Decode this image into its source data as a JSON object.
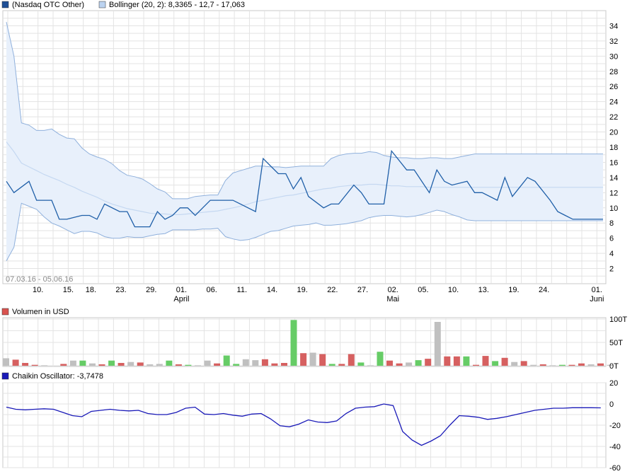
{
  "chart_data": [
    {
      "type": "line",
      "panel": "price",
      "legend": [
        {
          "label": "(Nasdaq OTC Other)",
          "color": "#1f5fa8"
        },
        {
          "label": "Bollinger (20, 2): 8,3365 - 12,7 - 17,063",
          "color": "#9cbde6"
        }
      ],
      "date_range": "07.03.16 - 05.06.16",
      "ylim": [
        0,
        36
      ],
      "yticks": [
        2,
        4,
        6,
        8,
        10,
        12,
        14,
        16,
        18,
        20,
        22,
        24,
        26,
        28,
        30,
        32,
        34
      ],
      "x_date_labels": [
        "10.",
        "15.",
        "18.",
        "23.",
        "29.",
        "01.",
        "06.",
        "11.",
        "14.",
        "19.",
        "22.",
        "27.",
        "02.",
        "05.",
        "10.",
        "13.",
        "19.",
        "24.",
        "01."
      ],
      "x_date_positions": [
        4,
        8,
        11,
        15,
        19,
        23,
        27,
        31,
        35,
        39,
        43,
        47,
        51,
        55,
        59,
        63,
        67,
        71,
        78
      ],
      "x_month_labels": [
        {
          "label": "April",
          "at": 23
        },
        {
          "label": "Mai",
          "at": 51
        },
        {
          "label": "Juni",
          "at": 78
        }
      ],
      "x_count": 80,
      "grid": true,
      "series": [
        {
          "x": [
            0,
            1,
            3,
            4,
            6,
            7,
            8,
            10,
            11,
            12,
            13,
            15,
            16,
            17,
            18,
            19,
            20,
            21,
            22,
            23,
            24,
            25,
            26,
            27,
            28,
            29,
            30,
            31,
            32,
            33,
            34,
            36,
            37,
            38,
            39,
            40,
            42,
            43,
            44,
            46,
            47,
            48,
            50,
            51,
            53,
            54,
            56,
            57,
            58,
            59,
            61,
            62,
            63,
            65,
            66,
            67,
            69,
            70,
            72,
            73,
            74,
            75,
            76,
            77,
            78,
            79
          ],
          "values": [
            13.5,
            12,
            13.5,
            11,
            11,
            8.5,
            8.5,
            9,
            9,
            8.5,
            10.5,
            9.5,
            9.5,
            7.5,
            7.5,
            7.5,
            9.5,
            8.5,
            9,
            10,
            10,
            9,
            10,
            11,
            11,
            11,
            11,
            10.5,
            10,
            9.5,
            16.5,
            14.5,
            14.5,
            12.5,
            14,
            11.5,
            10,
            10.5,
            10.5,
            13,
            12,
            10.5,
            10.5,
            17.5,
            15,
            15,
            12,
            15,
            13.5,
            13,
            13.5,
            12,
            12,
            11,
            14,
            11.5,
            14,
            13.5,
            11,
            9.5,
            9,
            8.5,
            8.5,
            8.5,
            8.5,
            8.5
          ]
        },
        {
          "name": "Bollinger (20, 2)",
          "x": [
            0,
            1,
            2,
            3,
            4,
            5,
            6,
            7,
            8,
            9,
            10,
            11,
            12,
            13,
            14,
            15,
            16,
            17,
            18,
            19,
            20,
            21,
            22,
            23,
            24,
            25,
            26,
            27,
            28,
            29,
            30,
            31,
            32,
            33,
            34,
            35,
            36,
            37,
            38,
            39,
            40,
            41,
            42,
            43,
            44,
            45,
            46,
            47,
            48,
            49,
            50,
            51,
            52,
            53,
            54,
            55,
            56,
            57,
            58,
            59,
            60,
            61,
            62,
            63,
            64,
            65,
            66,
            67,
            68,
            69,
            70,
            71,
            72,
            73,
            74,
            75,
            76,
            77,
            78,
            79
          ],
          "upper": [
            34.5,
            30,
            21.2,
            20.9,
            20.2,
            20.2,
            20.4,
            19.7,
            19.2,
            19.1,
            17.9,
            17.1,
            16.7,
            16.4,
            15.8,
            14.9,
            14.3,
            14.1,
            13.8,
            13.2,
            12.5,
            12.1,
            11.2,
            11.2,
            11.2,
            11.5,
            11.6,
            11.7,
            11.7,
            13.6,
            14.6,
            14.9,
            15.2,
            15.5,
            15.5,
            15.4,
            15.4,
            15.3,
            15.4,
            15.5,
            15.5,
            15.5,
            15.5,
            16.5,
            16.9,
            17.1,
            17.2,
            17.2,
            17.4,
            17.3,
            16.9,
            16.7,
            16.6,
            16.6,
            16.5,
            16.5,
            16.6,
            16.6,
            16.5,
            16.5,
            16.7,
            16.9,
            17.1,
            17.1,
            17.1,
            17.1,
            17.1,
            17.1,
            17.1,
            17.1,
            17.1,
            17.1,
            17.1,
            17.1,
            17.1,
            17.1,
            17.1,
            17.1,
            17.1,
            17.1
          ],
          "middle": [
            18.7,
            17.4,
            15.9,
            15.4,
            14.9,
            14.4,
            14.0,
            13.6,
            13.1,
            12.7,
            12.2,
            11.8,
            11.4,
            10.9,
            10.5,
            10.2,
            9.9,
            9.7,
            9.5,
            9.3,
            9.2,
            9.2,
            9.1,
            9.1,
            9.2,
            9.3,
            9.4,
            9.5,
            9.6,
            9.8,
            10.0,
            10.2,
            10.5,
            10.8,
            11.0,
            11.2,
            11.4,
            11.6,
            11.7,
            11.9,
            12.1,
            12.3,
            12.5,
            12.6,
            12.8,
            12.9,
            13.0,
            13.0,
            13.1,
            13.1,
            13.0,
            12.9,
            12.9,
            12.8,
            12.8,
            12.8,
            12.7,
            12.7,
            12.7,
            12.7,
            12.7,
            12.7,
            12.7,
            12.7,
            12.7,
            12.7,
            12.7,
            12.7,
            12.7,
            12.7,
            12.7,
            12.7,
            12.7,
            12.7,
            12.7,
            12.7,
            12.7,
            12.7,
            12.7,
            12.7
          ],
          "lower": [
            3,
            4.8,
            10.6,
            10.2,
            9.8,
            8.8,
            8.0,
            7.6,
            7.1,
            6.6,
            6.9,
            6.9,
            6.7,
            6.2,
            6.0,
            6.0,
            6.2,
            6.1,
            6.1,
            6.3,
            6.5,
            6.6,
            7.1,
            7.1,
            7.1,
            7.1,
            7.2,
            7.2,
            7.3,
            6.2,
            5.9,
            5.7,
            5.8,
            6.1,
            6.5,
            6.9,
            7.0,
            7.3,
            7.6,
            7.7,
            7.8,
            8.0,
            7.7,
            7.7,
            7.8,
            7.9,
            8.1,
            8.3,
            8.7,
            8.9,
            9.0,
            9.0,
            8.9,
            8.8,
            8.9,
            9.1,
            9.4,
            9.7,
            9.5,
            9.1,
            8.8,
            8.4,
            8.3,
            8.3,
            8.3,
            8.3,
            8.3,
            8.3,
            8.3,
            8.3,
            8.3,
            8.3,
            8.3,
            8.3,
            8.3,
            8.3,
            8.3,
            8.3,
            8.3,
            8.3
          ]
        }
      ]
    },
    {
      "type": "bar",
      "panel": "volume",
      "legend": [
        {
          "label": "Volumen in USD",
          "color": "#d9534f"
        }
      ],
      "ylim": [
        0,
        100
      ],
      "yticks": [
        {
          "v": 0,
          "label": "0T"
        },
        {
          "v": 50,
          "label": "50T"
        },
        {
          "v": 100,
          "label": "100T"
        }
      ],
      "color_key": {
        "up": "#66cc66",
        "down": "#d66060",
        "neutral": "#c0c0c0"
      },
      "bars": [
        {
          "x": 0,
          "v": 16,
          "c": "neutral"
        },
        {
          "x": 1,
          "v": 13,
          "c": "down"
        },
        {
          "x": 2,
          "v": 6,
          "c": "down"
        },
        {
          "x": 3,
          "v": 2,
          "c": "down"
        },
        {
          "x": 4,
          "v": 1,
          "c": "neutral"
        },
        {
          "x": 6,
          "v": 4,
          "c": "down"
        },
        {
          "x": 7,
          "v": 11,
          "c": "neutral"
        },
        {
          "x": 8,
          "v": 11,
          "c": "up"
        },
        {
          "x": 9,
          "v": 5,
          "c": "neutral"
        },
        {
          "x": 10,
          "v": 3,
          "c": "down"
        },
        {
          "x": 11,
          "v": 11,
          "c": "up"
        },
        {
          "x": 12,
          "v": 6,
          "c": "down"
        },
        {
          "x": 13,
          "v": 8,
          "c": "neutral"
        },
        {
          "x": 14,
          "v": 7,
          "c": "down"
        },
        {
          "x": 15,
          "v": 3,
          "c": "neutral"
        },
        {
          "x": 16,
          "v": 4,
          "c": "neutral"
        },
        {
          "x": 17,
          "v": 11,
          "c": "up"
        },
        {
          "x": 18,
          "v": 3,
          "c": "down"
        },
        {
          "x": 19,
          "v": 2,
          "c": "up"
        },
        {
          "x": 20,
          "v": 1,
          "c": "neutral"
        },
        {
          "x": 21,
          "v": 11,
          "c": "neutral"
        },
        {
          "x": 22,
          "v": 5,
          "c": "down"
        },
        {
          "x": 23,
          "v": 22,
          "c": "up"
        },
        {
          "x": 24,
          "v": 4,
          "c": "up"
        },
        {
          "x": 25,
          "v": 14,
          "c": "neutral"
        },
        {
          "x": 26,
          "v": 12,
          "c": "neutral"
        },
        {
          "x": 27,
          "v": 14,
          "c": "down"
        },
        {
          "x": 28,
          "v": 5,
          "c": "down"
        },
        {
          "x": 29,
          "v": 6,
          "c": "down"
        },
        {
          "x": 30,
          "v": 98,
          "c": "up"
        },
        {
          "x": 31,
          "v": 27,
          "c": "down"
        },
        {
          "x": 32,
          "v": 28,
          "c": "neutral"
        },
        {
          "x": 33,
          "v": 25,
          "c": "down"
        },
        {
          "x": 34,
          "v": 4,
          "c": "up"
        },
        {
          "x": 35,
          "v": 4,
          "c": "down"
        },
        {
          "x": 36,
          "v": 25,
          "c": "down"
        },
        {
          "x": 37,
          "v": 7,
          "c": "up"
        },
        {
          "x": 38,
          "v": 1,
          "c": "neutral"
        },
        {
          "x": 39,
          "v": 30,
          "c": "up"
        },
        {
          "x": 40,
          "v": 11,
          "c": "down"
        },
        {
          "x": 41,
          "v": 5,
          "c": "down"
        },
        {
          "x": 42,
          "v": 7,
          "c": "neutral"
        },
        {
          "x": 43,
          "v": 12,
          "c": "up"
        },
        {
          "x": 44,
          "v": 15,
          "c": "down"
        },
        {
          "x": 45,
          "v": 94,
          "c": "neutral"
        },
        {
          "x": 46,
          "v": 20,
          "c": "down"
        },
        {
          "x": 47,
          "v": 20,
          "c": "down"
        },
        {
          "x": 48,
          "v": 20,
          "c": "up"
        },
        {
          "x": 49,
          "v": 2,
          "c": "down"
        },
        {
          "x": 50,
          "v": 21,
          "c": "down"
        },
        {
          "x": 51,
          "v": 10,
          "c": "up"
        },
        {
          "x": 52,
          "v": 17,
          "c": "down"
        },
        {
          "x": 53,
          "v": 8,
          "c": "neutral"
        },
        {
          "x": 54,
          "v": 10,
          "c": "down"
        },
        {
          "x": 55,
          "v": 2,
          "c": "neutral"
        },
        {
          "x": 56,
          "v": 3,
          "c": "down"
        },
        {
          "x": 57,
          "v": 1,
          "c": "neutral"
        },
        {
          "x": 58,
          "v": 2,
          "c": "up"
        },
        {
          "x": 59,
          "v": 2,
          "c": "down"
        },
        {
          "x": 60,
          "v": 5,
          "c": "down"
        },
        {
          "x": 61,
          "v": 3,
          "c": "neutral"
        },
        {
          "x": 62,
          "v": 5,
          "c": "down"
        },
        {
          "x": 63,
          "v": 2,
          "c": "neutral"
        }
      ]
    },
    {
      "type": "line",
      "panel": "chaikin",
      "legend": [
        {
          "label": "Chaikin Oscillator: -3,7478",
          "color": "#1a1ab8"
        }
      ],
      "ylim": [
        -60,
        20
      ],
      "yticks": [
        -60,
        -40,
        -20,
        0,
        20
      ],
      "series": [
        {
          "name": "Chaikin Oscillator",
          "x": [
            0,
            1,
            2,
            3,
            4,
            5,
            6,
            7,
            8,
            9,
            10,
            11,
            12,
            13,
            14,
            15,
            16,
            17,
            18,
            19,
            20,
            21,
            22,
            23,
            24,
            25,
            26,
            27,
            28,
            29,
            30,
            31,
            32,
            33,
            34,
            35,
            36,
            37,
            38,
            39,
            40,
            41,
            42,
            43,
            44,
            45,
            46,
            47,
            48,
            49,
            50,
            51,
            52,
            53,
            54,
            55,
            56,
            57,
            58,
            59,
            60,
            61,
            62,
            63
          ],
          "values": [
            -3,
            -5,
            -5.5,
            -5,
            -4.5,
            -5,
            -8,
            -11,
            -12,
            -7,
            -6,
            -5,
            -6,
            -6.5,
            -6,
            -9,
            -10,
            -10,
            -8,
            -4,
            -3,
            -9.5,
            -10,
            -9,
            -10.5,
            -11.5,
            -9.5,
            -9,
            -14,
            -20.5,
            -21.5,
            -19,
            -15,
            -17,
            -17.5,
            -16,
            -9,
            -4,
            -3,
            -2.5,
            0,
            -1.5,
            -26,
            -34,
            -39,
            -35,
            -30,
            -20,
            -11,
            -11.5,
            -12.5,
            -14.5,
            -13.5,
            -12,
            -10,
            -8,
            -6,
            -5,
            -4,
            -4,
            -3.5,
            -3.5,
            -3.5,
            -3.7
          ]
        }
      ]
    }
  ]
}
